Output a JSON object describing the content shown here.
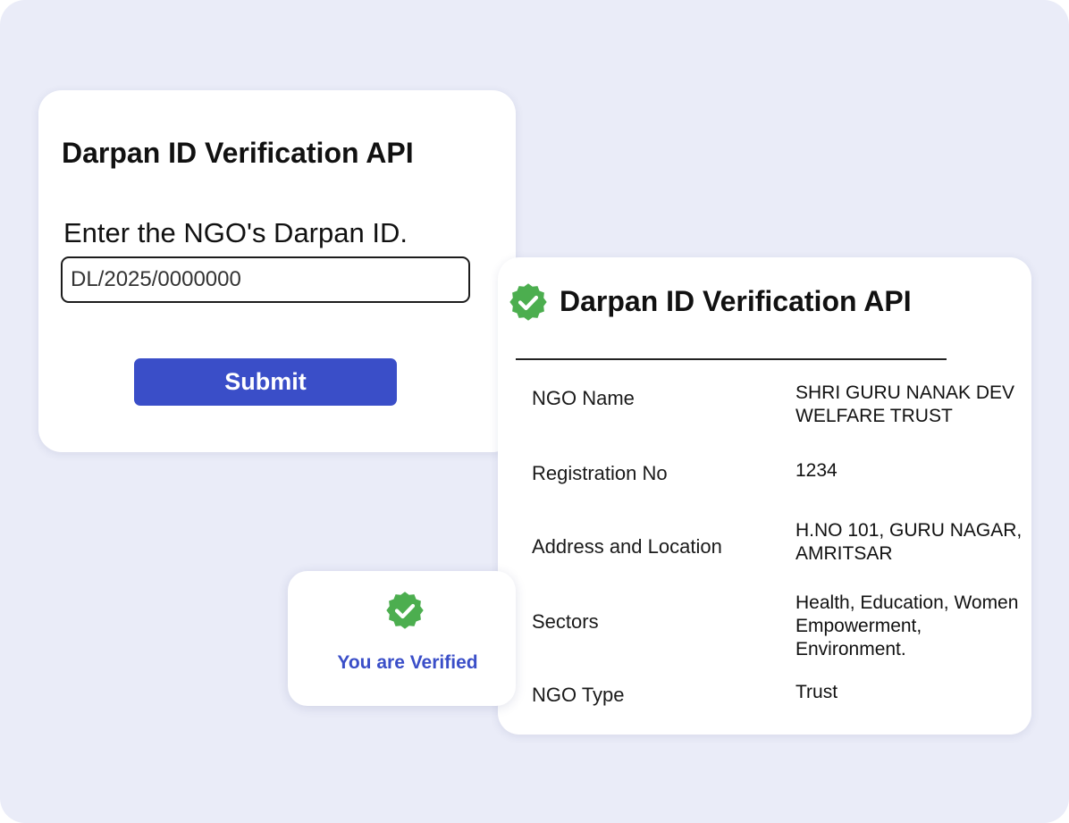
{
  "input_card": {
    "title": "Darpan ID Verification API",
    "field_label": "Enter the NGO's Darpan ID.",
    "input_value": "DL/2025/0000000",
    "submit_label": "Submit"
  },
  "result_card": {
    "title": "Darpan ID Verification API",
    "icon": "verified-badge-icon",
    "rows": [
      {
        "label": "NGO Name",
        "value": "SHRI GURU NANAK DEV WELFARE TRUST"
      },
      {
        "label": "Registration No",
        "value": "1234"
      },
      {
        "label": "Address and Location",
        "value": "H.NO 101, GURU NAGAR, AMRITSAR"
      },
      {
        "label": "Sectors",
        "value": "Health, Education, Women Empowerment, Environment."
      },
      {
        "label": "NGO Type",
        "value": "Trust"
      }
    ]
  },
  "verified_card": {
    "icon": "verified-badge-icon",
    "text": "You are Verified"
  },
  "colors": {
    "background": "#eaecf8",
    "accent": "#3a4ec8",
    "success": "#4cae4f",
    "text": "#111111"
  }
}
